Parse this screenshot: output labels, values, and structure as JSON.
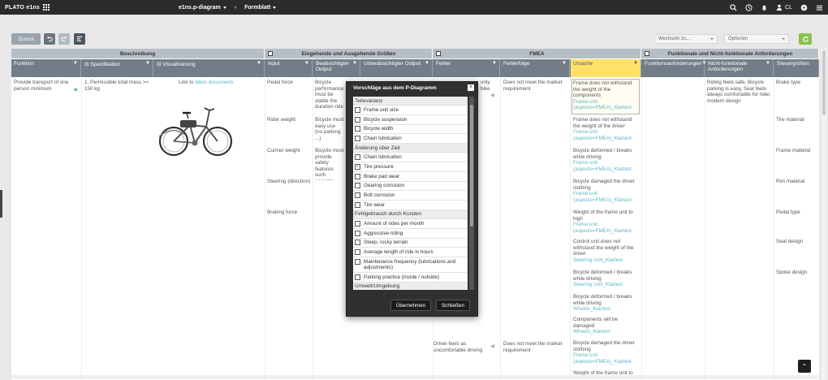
{
  "topbar": {
    "brand": "PLATO e1ns",
    "crumb1": "e1ns.p-diagram",
    "crumb2": "Formblatt",
    "user": "CL"
  },
  "toolbar": {
    "back_label": "Zurück",
    "select1": "Wechseln zu...",
    "select2": "Optionen"
  },
  "groups": [
    "Beschreibung",
    "Eingehende und Ausgehende Größen",
    "FMEA",
    "Funktionale und Nicht-funktionale Anforderungen"
  ],
  "columns": [
    "Funktion",
    "Spezifikation",
    "Visualisierung",
    "Input",
    "Beabsichtigter Output",
    "Unbeabsichtigter Output",
    "Fehler",
    "Fehlerfolge",
    "Ursache",
    "Funktionsanforderungen",
    "Nicht-funktionale Anforderungen",
    "Steuergrößen"
  ],
  "cells": {
    "funktion": "Provide transport of one person minimum",
    "spezifikation": "1. Permissible total mass >= 150 kg",
    "visual_prefix": "Link to",
    "visual_link": "bikes documents",
    "inputs": [
      "Pedal force",
      "Rider weight",
      "Curiner weight",
      "Steering (direction)",
      "Braking force"
    ],
    "beabs": [
      "Bicycle performance must be stable the duration ride",
      "Bicycle must easy use (no parking ...)",
      "Bicycle must provide safety features such acoustic signal, visual signal"
    ],
    "fehler_partial": "only bike",
    "fehlerfolge": "Does not meet the market requirement",
    "nf1": "Riding feels safe, Bicycle parking is easy, Seat feels always comfortable for rider, modern design",
    "steuer": [
      "Brake type",
      "Tire material",
      "Frame material",
      "Rim material",
      "Pedal type",
      "Seat design",
      "Spoke design"
    ],
    "causes": [
      {
        "text": "Frame does not withstand the weight of the components",
        "link": "Frame unit (aspects=FMEA)_Klartext"
      },
      {
        "text": "Frame does not withstand the weight of the driver",
        "link": "Frame unit (aspects=FMEA)_Klartext"
      },
      {
        "text": "Bicycle deformed / breaks while driving",
        "link": "Frame unit (aspects=FMEA)_Klartext"
      },
      {
        "text": "Bicycle damaged the driver clothing",
        "link": "Frame unit (aspects=FMEA)_Klartext"
      },
      {
        "text": "Weight of the frame unit to high",
        "link": "Frame unit (aspects=FMEA)_Klartext"
      },
      {
        "text": "Control unit does not withstand the weight of the driver",
        "link": "Steering Unit_Klartext"
      },
      {
        "text": "Bicycle deformed / breaks while driving",
        "link": "Steering Unit_Klartext"
      },
      {
        "text": "Bicycle deformed / breaks while driving",
        "link": "Wheels_Klartext"
      },
      {
        "text": "Components will be damaged",
        "link": "Wheels_Klartext"
      },
      {
        "text": "Bicycle damaged the driver clothing",
        "link": "Frame unit (aspects=FMEA)_Klartext"
      },
      {
        "text": "Weight of the frame unit to",
        "link": ""
      }
    ],
    "fehler2": "Driver feels as uncomfortable driving",
    "fehlerfolge2": "Does not meet the market requirement"
  },
  "modal": {
    "title": "Vorschläge aus dem P-Diagramm",
    "sections": [
      {
        "title": "Teilevarianz",
        "items": [
          "Frame unit size",
          "Bicycle suspension",
          "Bicycle width",
          "Chain lubrication"
        ]
      },
      {
        "title": "Änderung über Zeit",
        "items": [
          "Chain lubrication",
          "Tire pressure",
          "Brake pad wear",
          "Gearing corrosion",
          "Bolt corrosion",
          "Tire wear"
        ]
      },
      {
        "title": "Fehlgebrauch durch Kunden",
        "items": [
          "Amount of rides per month",
          "Aggressive riding",
          "Steep, rocky terrain",
          "Average length of ride in hours",
          "Maintenance frequency (lubrications and adjustments)",
          "Parking practice (inside / outside)"
        ]
      },
      {
        "title": "Umwelt/Umgebung",
        "items": []
      }
    ],
    "checked_item": "Tire pressure",
    "apply_label": "Übernehmen",
    "close_label": "Schließen"
  },
  "colors": {
    "topbar": "#2b2b2b",
    "group_header": "#b6bec6",
    "column_header": "#737d87",
    "active_column": "#ffe16a",
    "link": "#5fb6c9",
    "refresh": "#8bc34a"
  }
}
